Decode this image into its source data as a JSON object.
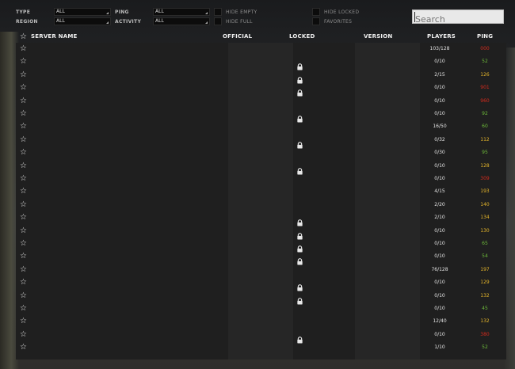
{
  "filters": {
    "type_label": "TYPE",
    "type_value": "ALL",
    "region_label": "REGION",
    "region_value": "ALL",
    "ping_label": "PING",
    "ping_value": "ALL",
    "activity_label": "ACTIVITY",
    "activity_value": "ALL",
    "hide_empty_label": "HIDE EMPTY",
    "hide_full_label": "HIDE FULL",
    "hide_locked_label": "HIDE LOCKED",
    "favorites_label": "FAVORITES"
  },
  "search": {
    "placeholder": "Search"
  },
  "columns": {
    "server_name": "SERVER NAME",
    "official": "OFFICIAL",
    "locked": "LOCKED",
    "version": "VERSION",
    "players": "PLAYERS",
    "ping": "PING"
  },
  "colors": {
    "ping_good": "#6dbb3a",
    "ping_mid": "#e3b42a",
    "ping_bad": "#d22a1c"
  },
  "rows": [
    {
      "locked": false,
      "players": "103/128",
      "ping": "000",
      "ping_class": "bad"
    },
    {
      "locked": true,
      "players": "0/10",
      "ping": "52",
      "ping_class": "good"
    },
    {
      "locked": true,
      "players": "2/15",
      "ping": "126",
      "ping_class": "mid"
    },
    {
      "locked": true,
      "players": "0/10",
      "ping": "901",
      "ping_class": "bad"
    },
    {
      "locked": false,
      "players": "0/10",
      "ping": "960",
      "ping_class": "bad"
    },
    {
      "locked": true,
      "players": "0/10",
      "ping": "92",
      "ping_class": "good"
    },
    {
      "locked": false,
      "players": "16/50",
      "ping": "60",
      "ping_class": "good"
    },
    {
      "locked": true,
      "players": "0/32",
      "ping": "112",
      "ping_class": "mid"
    },
    {
      "locked": false,
      "players": "0/30",
      "ping": "95",
      "ping_class": "good"
    },
    {
      "locked": true,
      "players": "0/10",
      "ping": "128",
      "ping_class": "mid"
    },
    {
      "locked": false,
      "players": "0/10",
      "ping": "309",
      "ping_class": "bad"
    },
    {
      "locked": false,
      "players": "4/15",
      "ping": "193",
      "ping_class": "mid"
    },
    {
      "locked": false,
      "players": "2/20",
      "ping": "140",
      "ping_class": "mid"
    },
    {
      "locked": true,
      "players": "2/10",
      "ping": "134",
      "ping_class": "mid"
    },
    {
      "locked": true,
      "players": "0/10",
      "ping": "130",
      "ping_class": "mid"
    },
    {
      "locked": true,
      "players": "0/10",
      "ping": "65",
      "ping_class": "good"
    },
    {
      "locked": true,
      "players": "0/10",
      "ping": "54",
      "ping_class": "good"
    },
    {
      "locked": false,
      "players": "76/128",
      "ping": "197",
      "ping_class": "mid"
    },
    {
      "locked": true,
      "players": "0/10",
      "ping": "129",
      "ping_class": "mid"
    },
    {
      "locked": true,
      "players": "0/10",
      "ping": "132",
      "ping_class": "mid"
    },
    {
      "locked": false,
      "players": "0/10",
      "ping": "45",
      "ping_class": "good"
    },
    {
      "locked": false,
      "players": "12/40",
      "ping": "132",
      "ping_class": "mid"
    },
    {
      "locked": true,
      "players": "0/10",
      "ping": "380",
      "ping_class": "bad"
    },
    {
      "locked": false,
      "players": "1/10",
      "ping": "52",
      "ping_class": "good"
    }
  ]
}
